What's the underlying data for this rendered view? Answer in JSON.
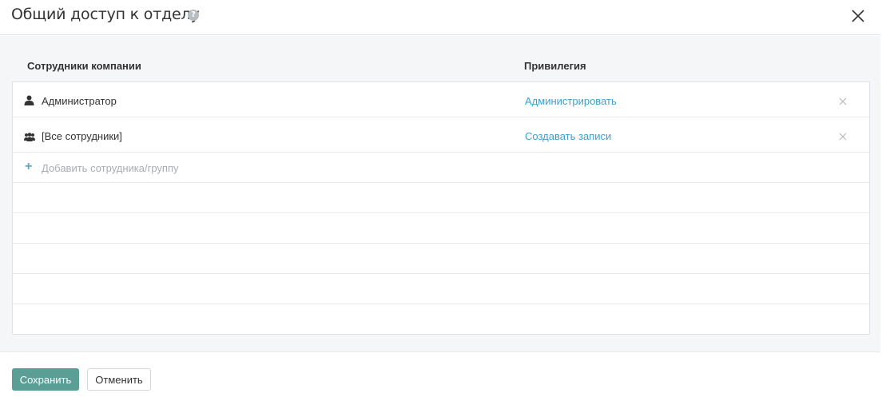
{
  "dialog": {
    "title": "Общий доступ к отделу",
    "help_icon": "help-icon",
    "close_icon": "close-icon"
  },
  "table": {
    "columns": {
      "employees": "Сотрудники компании",
      "privilege": "Привилегия"
    },
    "rows": [
      {
        "icon": "user-icon",
        "name": "Администратор",
        "privilege": "Администрировать",
        "remove_icon": "remove-icon"
      },
      {
        "icon": "group-icon",
        "name": "[Все сотрудники]",
        "privilege": "Создавать записи",
        "remove_icon": "remove-icon"
      }
    ],
    "add_label": "Добавить сотрудника/группу"
  },
  "footer": {
    "save_label": "Сохранить",
    "cancel_label": "Отменить"
  },
  "colors": {
    "link": "#3ea0c9",
    "save_button": "#5a9e96",
    "placeholder": "#a9adb2"
  }
}
